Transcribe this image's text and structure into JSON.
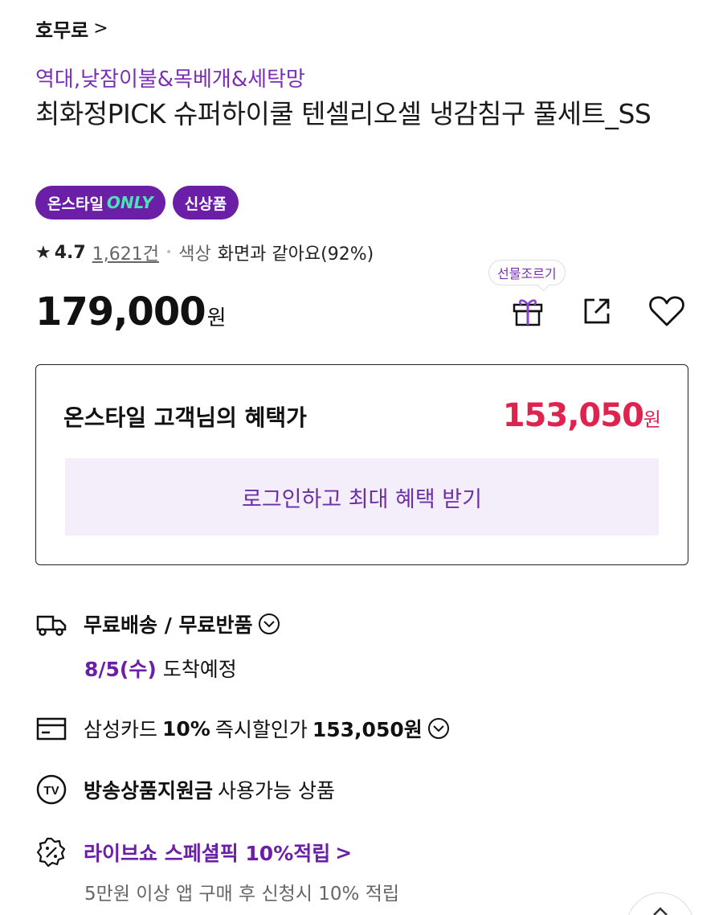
{
  "brand": {
    "label": "호무로",
    "chevron": ">"
  },
  "product": {
    "category": "역대,낮잠이불&목베개&세탁망",
    "title": "최화정PICK 슈퍼하이쿨 텐셀리오셀 냉감침구 풀세트_SS",
    "badges": {
      "onstyle": "온스타일",
      "only": "ONLY",
      "new": "신상품"
    },
    "rating": {
      "star": "★",
      "score": "4.7",
      "count": "1,621건",
      "separator": "•",
      "color_label": "색상",
      "color_value": "화면과 같아요(92%)"
    },
    "price": "179,000",
    "currency": "원"
  },
  "actions": {
    "gift_tooltip": "선물조르기",
    "icons": [
      "gift-icon",
      "share-icon",
      "heart-icon"
    ]
  },
  "benefit": {
    "label": "온스타일 고객님의 혜택가",
    "price": "153,050",
    "currency": "원",
    "login_button": "로그인하고 최대 혜택 받기"
  },
  "info": {
    "shipping": {
      "title": "무료배송 / 무료반품",
      "date": "8/5(수)",
      "arrival": "도착예정"
    },
    "card": {
      "name": "삼성카드",
      "discount": "10%",
      "desc": "즉시할인가",
      "price": "153,050원"
    },
    "tv": {
      "title": "방송상품지원금",
      "desc": "사용가능 상품"
    },
    "live": {
      "title": "라이브쇼 스페셜픽 10%적립",
      "chevron": ">",
      "desc": "5만원 이상 앱 구매 후 신청시 10% 적립"
    }
  },
  "colors": {
    "accent": "#6b1fa6",
    "sale": "#e0224f",
    "mint": "#4fe0b8",
    "login_bg": "#f4eefb"
  },
  "scroll_top": {
    "icon": "arrow-up-icon"
  }
}
